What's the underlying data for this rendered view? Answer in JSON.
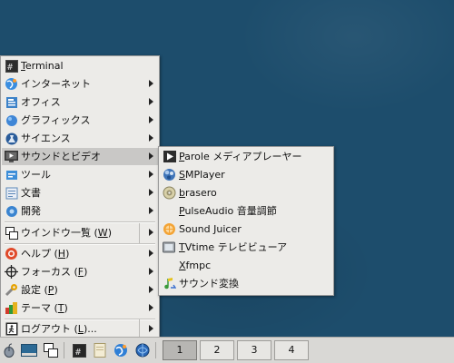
{
  "main_menu": {
    "items": [
      {
        "label": "Terminal",
        "underline": "T",
        "rest": "erminal",
        "icon": "terminal-icon",
        "submenu": false
      },
      {
        "label": "インターネット",
        "icon": "globe-icon",
        "submenu": true
      },
      {
        "label": "オフィス",
        "icon": "office-icon",
        "submenu": true
      },
      {
        "label": "グラフィックス",
        "icon": "graphics-icon",
        "submenu": true
      },
      {
        "label": "サイエンス",
        "icon": "science-icon",
        "submenu": true
      },
      {
        "label": "サウンドとビデオ",
        "icon": "multimedia-icon",
        "submenu": true
      },
      {
        "label": "ツール",
        "icon": "tools-icon",
        "submenu": true
      },
      {
        "label": "文書",
        "icon": "document-icon",
        "submenu": true
      },
      {
        "label": "開発",
        "icon": "development-icon",
        "submenu": true
      },
      {
        "label": "ウインドウ一覧 (W)",
        "pre": "ウインドウ一覧 (",
        "key": "W",
        "post": ")",
        "icon": "window-list-icon",
        "submenu": true
      },
      {
        "label": "ヘルプ (H)",
        "pre": "ヘルプ (",
        "key": "H",
        "post": ")",
        "icon": "help-icon",
        "submenu": true
      },
      {
        "label": "フォーカス (F)",
        "pre": "フォーカス (",
        "key": "F",
        "post": ")",
        "icon": "focus-icon",
        "submenu": true
      },
      {
        "label": "設定 (P)",
        "pre": "設定 (",
        "key": "P",
        "post": ")",
        "icon": "settings-icon",
        "submenu": true
      },
      {
        "label": "テーマ (T)",
        "pre": "テーマ (",
        "key": "T",
        "post": ")",
        "icon": "theme-icon",
        "submenu": true
      },
      {
        "label": "ログアウト (L)...",
        "pre": "ログアウト (",
        "key": "L",
        "post": ")...",
        "icon": "logout-icon",
        "submenu": true
      }
    ],
    "active_item": "サウンドとビデオ"
  },
  "sub_menu": {
    "items": [
      {
        "key": "P",
        "rest": "arole メディアプレーヤー",
        "icon": "parole-icon"
      },
      {
        "key": "S",
        "rest": "MPlayer",
        "icon": "smplayer-icon"
      },
      {
        "key": "b",
        "rest": "rasero",
        "icon": "brasero-icon"
      },
      {
        "key": "P",
        "rest": "ulseAudio 音量調節",
        "icon": "pulseaudio-icon"
      },
      {
        "key": "",
        "rest": "Sound Juicer",
        "icon": "sound-juicer-icon"
      },
      {
        "key": "T",
        "rest": "Vtime テレビビューア",
        "icon": "tvtime-icon"
      },
      {
        "key": "X",
        "rest": "fmpc",
        "icon": "blank-icon"
      },
      {
        "key": "",
        "rest": "サウンド変換",
        "icon": "sound-converter-icon"
      }
    ]
  },
  "taskbar": {
    "launchers": [
      "mouse-icon",
      "desktop-icon",
      "windows-icon",
      "terminal-icon",
      "files-icon",
      "browser-icon",
      "globe-icon"
    ],
    "workspaces": [
      "1",
      "2",
      "3",
      "4"
    ],
    "active_workspace": "1"
  },
  "colors": {
    "desktop": "#1d4d6c",
    "menu_bg": "#ecebe8",
    "highlight": "#c9c8c6",
    "taskbar": "#d9d8d5"
  }
}
